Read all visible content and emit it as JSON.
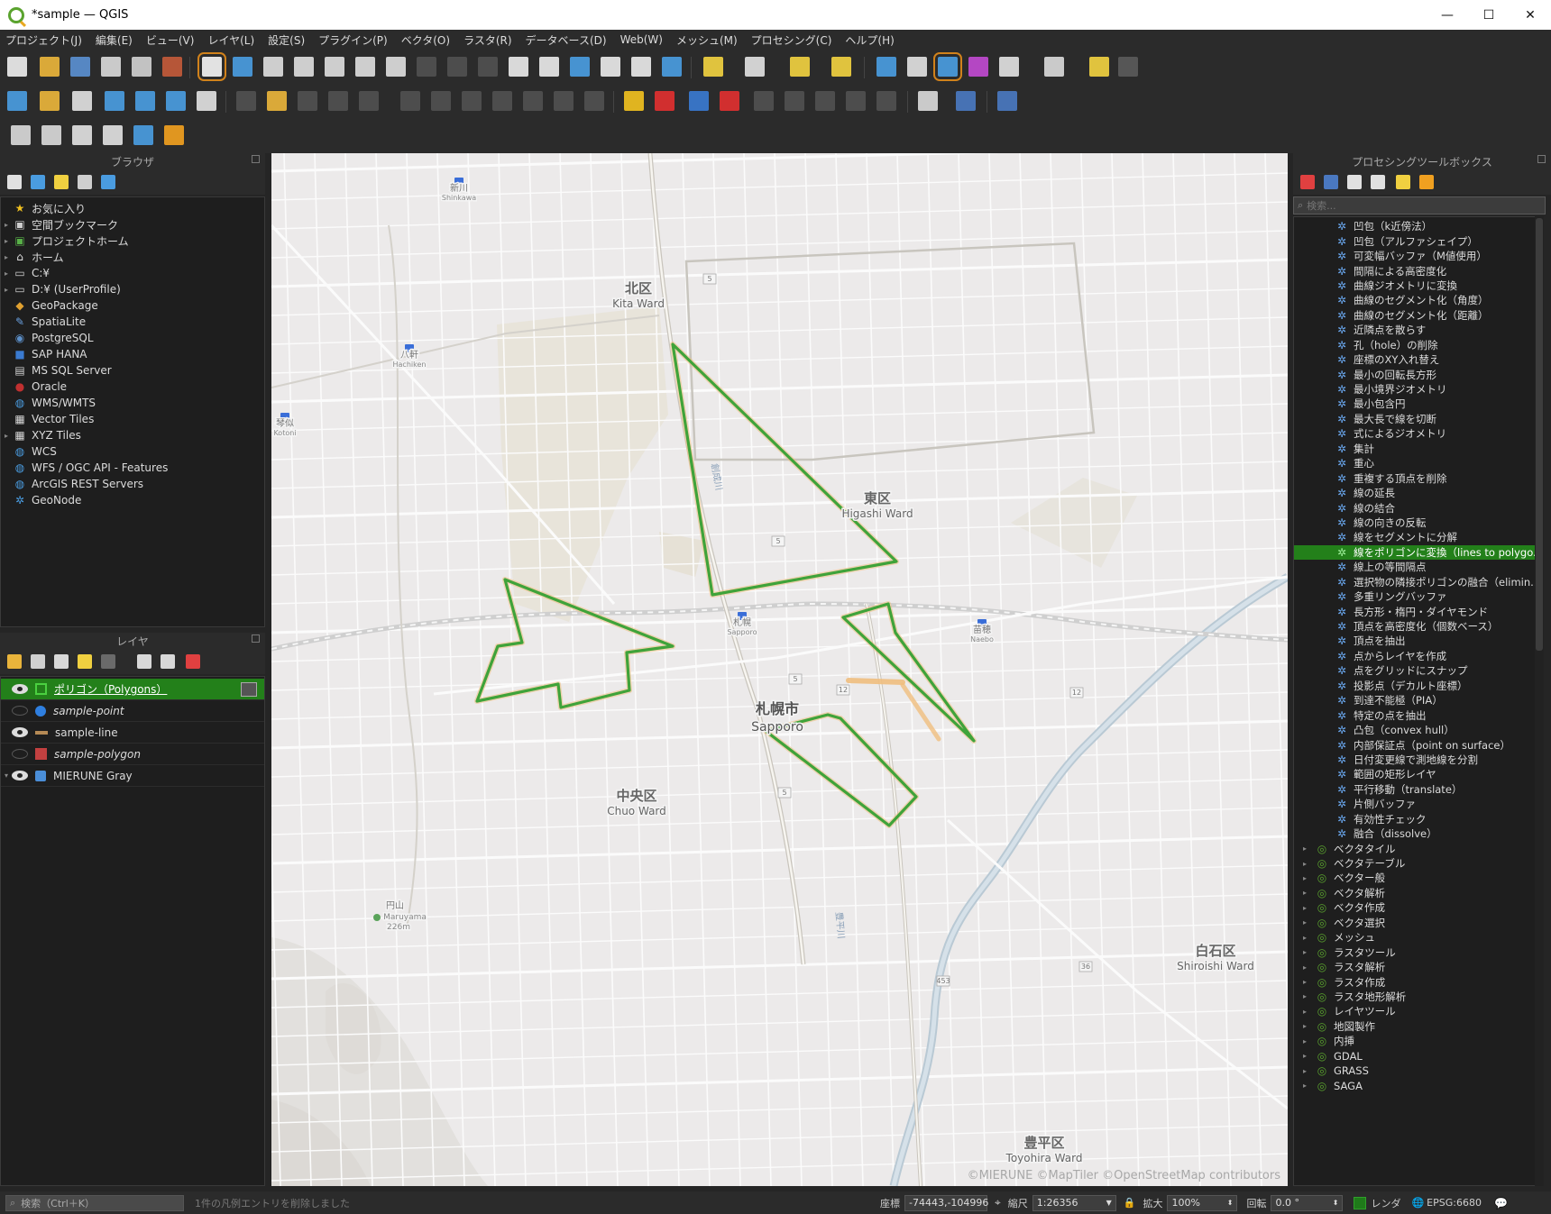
{
  "window": {
    "title": "*sample — QGIS",
    "minimize": "—",
    "maximize": "☐",
    "close": "✕"
  },
  "menu": [
    "プロジェクト(J)",
    "編集(E)",
    "ビュー(V)",
    "レイヤ(L)",
    "設定(S)",
    "プラグイン(P)",
    "ベクタ(O)",
    "ラスタ(R)",
    "データベース(D)",
    "Web(W)",
    "メッシュ(M)",
    "プロセシング(C)",
    "ヘルプ(H)"
  ],
  "browser": {
    "title": "ブラウザ",
    "items": [
      {
        "label": "お気に入り",
        "icon": "star-icon",
        "arrow": ""
      },
      {
        "label": "空間ブックマーク",
        "icon": "bookmark-icon",
        "arrow": "▸"
      },
      {
        "label": "プロジェクトホーム",
        "icon": "project-home-icon",
        "arrow": "▸"
      },
      {
        "label": "ホーム",
        "icon": "home-folder-icon",
        "arrow": "▸"
      },
      {
        "label": "C:¥",
        "icon": "drive-icon",
        "arrow": "▸"
      },
      {
        "label": "D:¥ (UserProfile)",
        "icon": "drive-icon",
        "arrow": "▸"
      },
      {
        "label": "GeoPackage",
        "icon": "geopackage-icon",
        "arrow": ""
      },
      {
        "label": "SpatiaLite",
        "icon": "spatialite-icon",
        "arrow": ""
      },
      {
        "label": "PostgreSQL",
        "icon": "postgresql-icon",
        "arrow": ""
      },
      {
        "label": "SAP HANA",
        "icon": "sap-hana-icon",
        "arrow": ""
      },
      {
        "label": "MS SQL Server",
        "icon": "mssql-icon",
        "arrow": ""
      },
      {
        "label": "Oracle",
        "icon": "oracle-icon",
        "arrow": ""
      },
      {
        "label": "WMS/WMTS",
        "icon": "wms-icon",
        "arrow": ""
      },
      {
        "label": "Vector Tiles",
        "icon": "vector-tiles-icon",
        "arrow": ""
      },
      {
        "label": "XYZ Tiles",
        "icon": "xyz-tiles-icon",
        "arrow": "▸"
      },
      {
        "label": "WCS",
        "icon": "wcs-icon",
        "arrow": ""
      },
      {
        "label": "WFS / OGC API - Features",
        "icon": "wfs-icon",
        "arrow": ""
      },
      {
        "label": "ArcGIS REST Servers",
        "icon": "arcgis-icon",
        "arrow": ""
      },
      {
        "label": "GeoNode",
        "icon": "geonode-icon",
        "arrow": ""
      }
    ]
  },
  "layers": {
    "title": "レイヤ",
    "items": [
      {
        "label": "ポリゴン（Polygons）",
        "visible": true,
        "italic": false,
        "selected": true,
        "swatch": "#23801a",
        "swatch_type": "polygon-outline",
        "arrow": ""
      },
      {
        "label": "sample-point",
        "visible": false,
        "italic": true,
        "selected": false,
        "swatch": "#2f7fe0",
        "swatch_type": "point",
        "arrow": ""
      },
      {
        "label": "sample-line",
        "visible": true,
        "italic": false,
        "selected": false,
        "swatch": "#b58a55",
        "swatch_type": "line",
        "arrow": ""
      },
      {
        "label": "sample-polygon",
        "visible": false,
        "italic": true,
        "selected": false,
        "swatch": "#c24040",
        "swatch_type": "polygon-fill",
        "arrow": ""
      },
      {
        "label": "MIERUNE Gray",
        "visible": true,
        "italic": false,
        "selected": false,
        "swatch": "#4a8ed8",
        "swatch_type": "tile",
        "arrow": "▾"
      }
    ]
  },
  "processing": {
    "title": "プロセシングツールボックス",
    "search_placeholder": "検索...",
    "algorithms": [
      "凹包（k近傍法）",
      "凹包（アルファシェイプ）",
      "可変幅バッファ（M値使用）",
      "間隔による高密度化",
      "曲線ジオメトリに変換",
      "曲線のセグメント化（角度）",
      "曲線のセグメント化（距離）",
      "近隣点を散らす",
      "孔（hole）の削除",
      "座標のXY入れ替え",
      "最小の回転長方形",
      "最小境界ジオメトリ",
      "最小包含円",
      "最大長で線を切断",
      "式によるジオメトリ",
      "集計",
      "重心",
      "重複する頂点を削除",
      "線の延長",
      "線の結合",
      "線の向きの反転",
      "線をセグメントに分解",
      "線をポリゴンに変換（lines to polygo...",
      "線上の等間隔点",
      "選択物の隣接ポリゴンの融合（elimin...",
      "多重リングバッファ",
      "長方形・楕円・ダイヤモンド",
      "頂点を高密度化（個数ベース）",
      "頂点を抽出",
      "点からレイヤを作成",
      "点をグリッドにスナップ",
      "投影点（デカルト座標）",
      "到達不能極（PIA）",
      "特定の点を抽出",
      "凸包（convex hull）",
      "内部保証点（point on surface）",
      "日付変更線で測地線を分割",
      "範囲の矩形レイヤ",
      "平行移動（translate）",
      "片側バッファ",
      "有効性チェック",
      "融合（dissolve）"
    ],
    "selected_index": 22,
    "groups": [
      "ベクタタイル",
      "ベクタテーブル",
      "ベクター般",
      "ベクタ解析",
      "ベクタ作成",
      "ベクタ選択",
      "メッシュ",
      "ラスタツール",
      "ラスタ解析",
      "ラスタ作成",
      "ラスタ地形解析",
      "レイヤツール",
      "地図製作",
      "内挿",
      "GDAL",
      "GRASS",
      "SAGA"
    ]
  },
  "map": {
    "wards": [
      {
        "ja": "北区",
        "en": "Kita Ward"
      },
      {
        "ja": "東区",
        "en": "Higashi Ward"
      },
      {
        "ja": "中央区",
        "en": "Chuo Ward"
      },
      {
        "ja": "白石区",
        "en": "Shiroishi Ward"
      },
      {
        "ja": "豊平区",
        "en": "Toyohira Ward"
      }
    ],
    "city": {
      "ja": "札幌市",
      "en": "Sapporo"
    },
    "stations": [
      {
        "ja": "新川",
        "en": "Shinkawa"
      },
      {
        "ja": "八軒",
        "en": "Hachiken"
      },
      {
        "ja": "琴似",
        "en": "Kotoni"
      },
      {
        "ja": "札幌",
        "en": "Sapporo"
      },
      {
        "ja": "苗穂",
        "en": "Naebo"
      }
    ],
    "mountain": {
      "ja": "円山",
      "en": "Maruyama",
      "elev": "226m"
    },
    "rivers": [
      "創成川",
      "豊平川"
    ],
    "route_numbers": [
      "5",
      "5",
      "5",
      "12",
      "12",
      "36",
      "453",
      "5"
    ],
    "attribution": "©MIERUNE ©MapTiler ©OpenStreetMap contributors",
    "polygon_color": "#3fa33a",
    "line_color": "#f0be7e"
  },
  "status": {
    "locator_placeholder": "検索（Ctrl＋K）",
    "message": "1件の凡例エントリを削除しました",
    "coord_label": "座標",
    "coord_value": "-74443,-104996",
    "scale_label": "縮尺",
    "scale_value": "1:26356",
    "magnifier_label": "拡大",
    "magnifier_value": "100%",
    "rotation_label": "回転",
    "rotation_value": "0.0 °",
    "render_label": "レンダ",
    "crs": "EPSG:6680"
  }
}
